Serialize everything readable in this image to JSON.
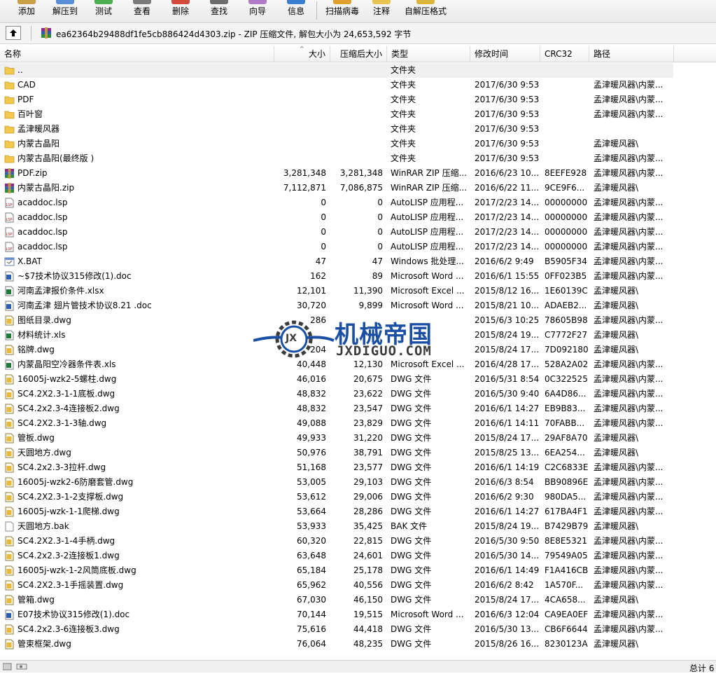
{
  "toolbar": {
    "buttons": [
      {
        "label": "添加",
        "icon": "add-icon",
        "color": "#c9a046"
      },
      {
        "label": "解压到",
        "icon": "extract-icon",
        "color": "#5b8ed8"
      },
      {
        "label": "测试",
        "icon": "test-icon",
        "color": "#4caf50"
      },
      {
        "label": "查看",
        "icon": "view-icon",
        "color": "#7a7a7a"
      },
      {
        "label": "删除",
        "icon": "delete-icon",
        "color": "#d44a3a"
      },
      {
        "label": "查找",
        "icon": "find-icon",
        "color": "#6d6d6d"
      },
      {
        "label": "向导",
        "icon": "wizard-icon",
        "color": "#b07ac8"
      },
      {
        "label": "信息",
        "icon": "info-icon",
        "color": "#3a7fd0"
      },
      {
        "label": "扫描病毒",
        "icon": "virus-scan-icon",
        "color": "#e0a030"
      },
      {
        "label": "注释",
        "icon": "comment-icon",
        "color": "#e8c450"
      },
      {
        "label": "自解压格式",
        "icon": "sfx-icon",
        "color": "#d9b53a"
      }
    ]
  },
  "address": {
    "text": "ea62364b29488df1fe5cb886424d4303.zip - ZIP 压缩文件, 解包大小为 24,653,592 字节"
  },
  "columns": {
    "name": "名称",
    "size": "大小",
    "packed": "压缩后大小",
    "type": "类型",
    "modified": "修改时间",
    "crc": "CRC32",
    "path": "路径"
  },
  "files": [
    {
      "name": "..",
      "size": "",
      "packed": "",
      "type": "文件夹",
      "date": "",
      "crc": "",
      "path": "",
      "icon": "folder-icon",
      "parent": true
    },
    {
      "name": "CAD",
      "size": "",
      "packed": "",
      "type": "文件夹",
      "date": "2017/6/30 9:53",
      "crc": "",
      "path": "孟津暖风器\\内蒙...",
      "icon": "folder-icon"
    },
    {
      "name": "PDF",
      "size": "",
      "packed": "",
      "type": "文件夹",
      "date": "2017/6/30 9:53",
      "crc": "",
      "path": "孟津暖风器\\内蒙...",
      "icon": "folder-icon"
    },
    {
      "name": "百叶窗",
      "size": "",
      "packed": "",
      "type": "文件夹",
      "date": "2017/6/30 9:53",
      "crc": "",
      "path": "孟津暖风器\\内蒙...",
      "icon": "folder-icon"
    },
    {
      "name": "孟津暖风器",
      "size": "",
      "packed": "",
      "type": "文件夹",
      "date": "2017/6/30 9:53",
      "crc": "",
      "path": "",
      "icon": "folder-icon"
    },
    {
      "name": "内蒙古晶阳",
      "size": "",
      "packed": "",
      "type": "文件夹",
      "date": "2017/6/30 9:53",
      "crc": "",
      "path": "孟津暖风器\\",
      "icon": "folder-icon"
    },
    {
      "name": "内蒙古晶阳(最终版 )",
      "size": "",
      "packed": "",
      "type": "文件夹",
      "date": "2017/6/30 9:53",
      "crc": "",
      "path": "孟津暖风器\\内蒙...",
      "icon": "folder-icon"
    },
    {
      "name": "PDF.zip",
      "size": "3,281,348",
      "packed": "3,281,348",
      "type": "WinRAR ZIP 压缩...",
      "date": "2016/6/23 10...",
      "crc": "8EEFE928",
      "path": "孟津暖风器\\内蒙...",
      "icon": "archive-icon"
    },
    {
      "name": "内蒙古晶阳.zip",
      "size": "7,112,871",
      "packed": "7,086,875",
      "type": "WinRAR ZIP 压缩...",
      "date": "2016/6/22 11...",
      "crc": "9CE9F6...",
      "path": "孟津暖风器\\",
      "icon": "archive-icon"
    },
    {
      "name": "acaddoc.lsp",
      "size": "0",
      "packed": "0",
      "type": "AutoLISP 应用程...",
      "date": "2017/2/23 14...",
      "crc": "00000000",
      "path": "孟津暖风器\\内蒙...",
      "icon": "lsp-file-icon"
    },
    {
      "name": "acaddoc.lsp",
      "size": "0",
      "packed": "0",
      "type": "AutoLISP 应用程...",
      "date": "2017/2/23 14...",
      "crc": "00000000",
      "path": "孟津暖风器\\内蒙...",
      "icon": "lsp-file-icon"
    },
    {
      "name": "acaddoc.lsp",
      "size": "0",
      "packed": "0",
      "type": "AutoLISP 应用程...",
      "date": "2017/2/23 14...",
      "crc": "00000000",
      "path": "孟津暖风器\\内蒙...",
      "icon": "lsp-file-icon"
    },
    {
      "name": "acaddoc.lsp",
      "size": "0",
      "packed": "0",
      "type": "AutoLISP 应用程...",
      "date": "2017/2/23 14...",
      "crc": "00000000",
      "path": "孟津暖风器\\内蒙...",
      "icon": "lsp-file-icon"
    },
    {
      "name": "X.BAT",
      "size": "47",
      "packed": "47",
      "type": "Windows 批处理...",
      "date": "2016/6/2 9:49",
      "crc": "B5905F34",
      "path": "孟津暖风器\\内蒙...",
      "icon": "bat-file-icon"
    },
    {
      "name": "~$7技术协议315修改(1).doc",
      "size": "162",
      "packed": "89",
      "type": "Microsoft Word ...",
      "date": "2016/6/1 15:55",
      "crc": "0FF023B5",
      "path": "孟津暖风器\\内蒙...",
      "icon": "word-file-icon"
    },
    {
      "name": "河南孟津报价条件.xlsx",
      "size": "12,101",
      "packed": "11,390",
      "type": "Microsoft Excel ...",
      "date": "2015/8/12 16...",
      "crc": "1E60139C",
      "path": "孟津暖风器\\",
      "icon": "excel-file-icon"
    },
    {
      "name": "河南孟津 翅片管技术协议8.21 .doc",
      "size": "30,720",
      "packed": "9,899",
      "type": "Microsoft Word ...",
      "date": "2015/8/21 10...",
      "crc": "ADAEB2...",
      "path": "孟津暖风器\\",
      "icon": "word-file-icon"
    },
    {
      "name": "图纸目录.dwg",
      "size": "286",
      "packed": "",
      "type": "",
      "date": "2015/6/3 10:25",
      "crc": "78605B98",
      "path": "孟津暖风器\\内蒙...",
      "icon": "dwg-file-icon"
    },
    {
      "name": "材料统计.xls",
      "size": "",
      "packed": "",
      "type": "",
      "date": "2015/8/24 19...",
      "crc": "C7772F27",
      "path": "孟津暖风器\\",
      "icon": "excel-file-icon"
    },
    {
      "name": "铭牌.dwg",
      "size": "204",
      "packed": "",
      "type": "",
      "date": "2015/8/24 17...",
      "crc": "7D092180",
      "path": "孟津暖风器\\",
      "icon": "dwg-file-icon"
    },
    {
      "name": "内蒙晶阳空冷器条件表.xls",
      "size": "40,448",
      "packed": "12,130",
      "type": "Microsoft Excel ...",
      "date": "2016/4/28 17...",
      "crc": "528A2A02",
      "path": "孟津暖风器\\内蒙...",
      "icon": "excel-file-icon"
    },
    {
      "name": "16005j-wzk2-5螺柱.dwg",
      "size": "46,016",
      "packed": "20,675",
      "type": "DWG 文件",
      "date": "2016/5/31 8:54",
      "crc": "0C322525",
      "path": "孟津暖风器\\内蒙...",
      "icon": "dwg-file-icon"
    },
    {
      "name": "SC4.2X2.3-1-1底板.dwg",
      "size": "48,832",
      "packed": "23,622",
      "type": "DWG 文件",
      "date": "2016/5/30 9:40",
      "crc": "6A4D86...",
      "path": "孟津暖风器\\内蒙...",
      "icon": "dwg-file-icon"
    },
    {
      "name": "SC4.2x2.3-4连接板2.dwg",
      "size": "48,832",
      "packed": "23,547",
      "type": "DWG 文件",
      "date": "2016/6/1 14:27",
      "crc": "EB9B83...",
      "path": "孟津暖风器\\内蒙...",
      "icon": "dwg-file-icon"
    },
    {
      "name": "SC4.2X2.3-1-3轴.dwg",
      "size": "49,088",
      "packed": "23,829",
      "type": "DWG 文件",
      "date": "2016/6/1 14:11",
      "crc": "70FABB...",
      "path": "孟津暖风器\\内蒙...",
      "icon": "dwg-file-icon"
    },
    {
      "name": "管板.dwg",
      "size": "49,933",
      "packed": "31,220",
      "type": "DWG 文件",
      "date": "2015/8/24 17...",
      "crc": "29AF8A70",
      "path": "孟津暖风器\\",
      "icon": "dwg-file-icon"
    },
    {
      "name": "天圆地方.dwg",
      "size": "50,976",
      "packed": "38,791",
      "type": "DWG 文件",
      "date": "2015/8/25 13...",
      "crc": "6EA254...",
      "path": "孟津暖风器\\",
      "icon": "dwg-file-icon"
    },
    {
      "name": "SC4.2x2.3-3拉杆.dwg",
      "size": "51,168",
      "packed": "23,577",
      "type": "DWG 文件",
      "date": "2016/6/1 14:19",
      "crc": "C2C6833E",
      "path": "孟津暖风器\\内蒙...",
      "icon": "dwg-file-icon"
    },
    {
      "name": "16005j-wzk2-6防磨套管.dwg",
      "size": "53,005",
      "packed": "29,103",
      "type": "DWG 文件",
      "date": "2016/6/3 8:54",
      "crc": "BB90896E",
      "path": "孟津暖风器\\内蒙...",
      "icon": "dwg-file-icon"
    },
    {
      "name": "SC4.2X2.3-1-2支撑板.dwg",
      "size": "53,612",
      "packed": "29,006",
      "type": "DWG 文件",
      "date": "2016/6/2 9:30",
      "crc": "980DA5...",
      "path": "孟津暖风器\\内蒙...",
      "icon": "dwg-file-icon"
    },
    {
      "name": "16005j-wzk-1-1爬梯.dwg",
      "size": "53,664",
      "packed": "28,286",
      "type": "DWG 文件",
      "date": "2016/6/1 14:27",
      "crc": "617BA4F1",
      "path": "孟津暖风器\\内蒙...",
      "icon": "dwg-file-icon"
    },
    {
      "name": "天圆地方.bak",
      "size": "53,933",
      "packed": "35,425",
      "type": "BAK 文件",
      "date": "2015/8/24 19...",
      "crc": "B7429B79",
      "path": "孟津暖风器\\",
      "icon": "blank-file-icon"
    },
    {
      "name": "SC4.2X2.3-1-4手柄.dwg",
      "size": "60,320",
      "packed": "22,815",
      "type": "DWG 文件",
      "date": "2016/5/30 9:50",
      "crc": "8E8E5321",
      "path": "孟津暖风器\\内蒙...",
      "icon": "dwg-file-icon"
    },
    {
      "name": "SC4.2x2.3-2连接板1.dwg",
      "size": "63,648",
      "packed": "24,601",
      "type": "DWG 文件",
      "date": "2016/5/30 14...",
      "crc": "79549A05",
      "path": "孟津暖风器\\内蒙...",
      "icon": "dwg-file-icon"
    },
    {
      "name": "16005j-wzk-1-2风筒底板.dwg",
      "size": "65,184",
      "packed": "25,178",
      "type": "DWG 文件",
      "date": "2016/6/1 14:49",
      "crc": "F1A416CB",
      "path": "孟津暖风器\\内蒙...",
      "icon": "dwg-file-icon"
    },
    {
      "name": "SC4.2X2.3-1手摇装置.dwg",
      "size": "65,962",
      "packed": "40,556",
      "type": "DWG 文件",
      "date": "2016/6/2 8:42",
      "crc": "1A570F...",
      "path": "孟津暖风器\\内蒙...",
      "icon": "dwg-file-icon"
    },
    {
      "name": "管箱.dwg",
      "size": "67,030",
      "packed": "46,150",
      "type": "DWG 文件",
      "date": "2015/8/24 17...",
      "crc": "4CA658...",
      "path": "孟津暖风器\\",
      "icon": "dwg-file-icon"
    },
    {
      "name": "E07技术协议315修改(1).doc",
      "size": "70,144",
      "packed": "19,515",
      "type": "Microsoft Word ...",
      "date": "2016/6/3 12:04",
      "crc": "CA9EA0EF",
      "path": "孟津暖风器\\内蒙...",
      "icon": "word-file-icon"
    },
    {
      "name": "SC4.2x2.3-6连接板3.dwg",
      "size": "75,616",
      "packed": "44,418",
      "type": "DWG 文件",
      "date": "2016/5/30 13...",
      "crc": "CB6F6644",
      "path": "孟津暖风器\\内蒙...",
      "icon": "dwg-file-icon"
    },
    {
      "name": "管束框架.dwg",
      "size": "76,064",
      "packed": "48,235",
      "type": "DWG 文件",
      "date": "2015/8/26 16...",
      "crc": "8230123A",
      "path": "孟津暖风器\\",
      "icon": "dwg-file-icon"
    }
  ],
  "watermark": {
    "title": "机械帝国",
    "subtitle": "JXDIGUO.COM",
    "badge": "JX"
  },
  "status": {
    "total": "总计 6"
  },
  "colors": {
    "folder": "#f2c94c",
    "dwg": "#e8b83a",
    "word": "#2b5fb0",
    "excel": "#1f7a3a",
    "archive": "#8b2a8b",
    "watermark_blue": "#1b4fa3",
    "watermark_gray": "#3c3c3c"
  }
}
